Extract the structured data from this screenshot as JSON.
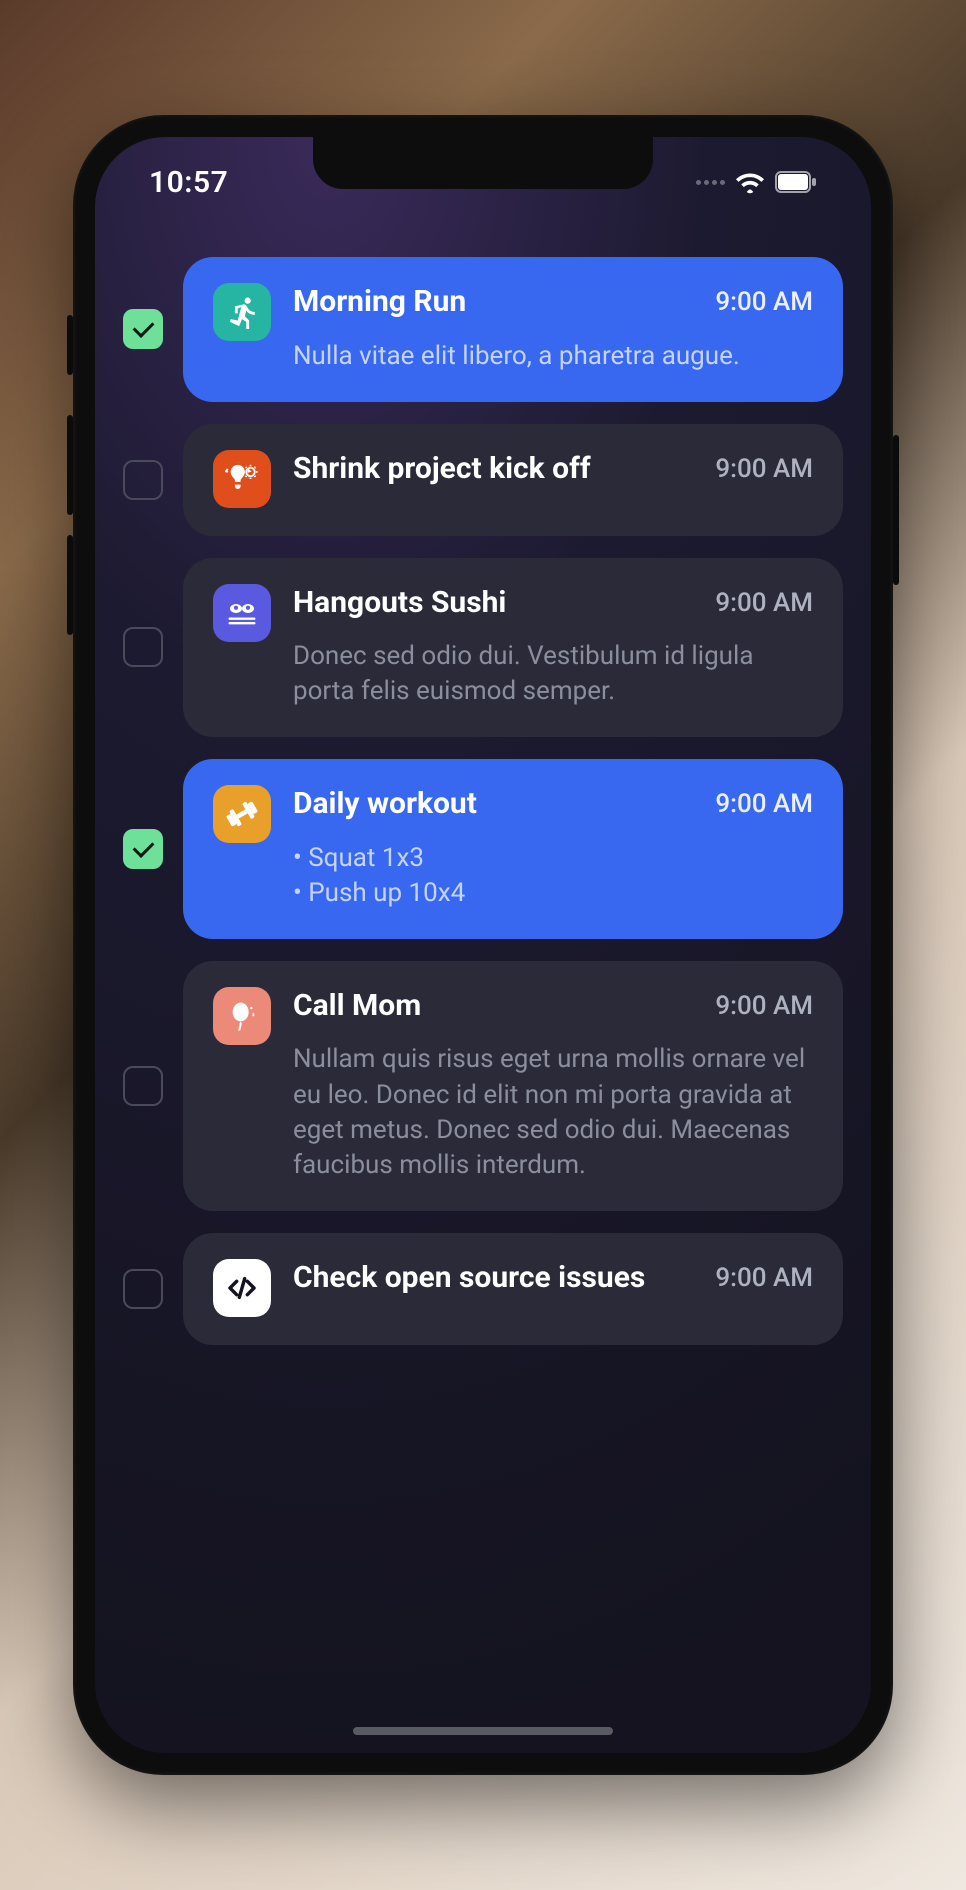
{
  "status": {
    "time": "10:57"
  },
  "colors": {
    "accent": "#3868ef",
    "card_unselected": "#2a2a38",
    "checkbox_checked": "#6ee09a"
  },
  "tasks": [
    {
      "checked": true,
      "icon": "running-icon",
      "icon_bg": "#27b5a3",
      "title": "Morning Run",
      "time": "9:00 AM",
      "desc": "Nulla vitae elit libero, a pharetra augue.",
      "desc_type": "text"
    },
    {
      "checked": false,
      "icon": "idea-gear-icon",
      "icon_bg": "#e04e1b",
      "title": "Shrink project kick off",
      "time": "9:00 AM",
      "desc": "",
      "desc_type": "none"
    },
    {
      "checked": false,
      "icon": "sushi-icon",
      "icon_bg": "#5a5ae0",
      "title": "Hangouts Sushi",
      "time": "9:00 AM",
      "desc": "Donec sed odio dui. Vestibulum id ligula porta felis euismod semper.",
      "desc_type": "text"
    },
    {
      "checked": true,
      "icon": "dumbbell-icon",
      "icon_bg": "#e8a02a",
      "title": "Daily workout",
      "time": "9:00 AM",
      "desc_items": [
        "Squat 1x3",
        "Push up 10x4"
      ],
      "desc_type": "list"
    },
    {
      "checked": false,
      "icon": "balloon-icon",
      "icon_bg": "#ec8a7a",
      "title": "Call Mom",
      "time": "9:00 AM",
      "desc": "Nullam quis risus eget urna mollis ornare vel eu leo. Donec id elit non mi porta gravida at eget metus. Donec sed odio dui. Maecenas faucibus mollis interdum.",
      "desc_type": "text"
    },
    {
      "checked": false,
      "icon": "code-icon",
      "icon_bg": "#ffffff",
      "title": "Check open source issues",
      "time": "9:00 AM",
      "desc": "",
      "desc_type": "none"
    }
  ]
}
